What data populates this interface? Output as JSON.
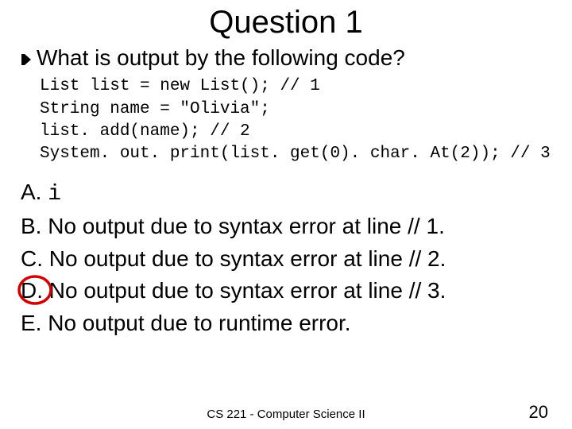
{
  "title": "Question 1",
  "prompt": "What is output by the following code?",
  "code": {
    "l1": "List list = new List(); // 1",
    "l2": "String name = \"Olivia\";",
    "l3": "list. add(name); // 2",
    "l4": "System. out. print(list. get(0). char. At(2)); // 3"
  },
  "answers": {
    "a_prefix": "A. ",
    "a_value": "i",
    "b": "B. No output due to syntax error at line // 1.",
    "c": "C. No output due to syntax error at line // 2.",
    "d": "D. No output due to syntax error at line // 3.",
    "e": "E. No output due to runtime error."
  },
  "footer": "CS 221 - Computer Science II",
  "page": "20"
}
